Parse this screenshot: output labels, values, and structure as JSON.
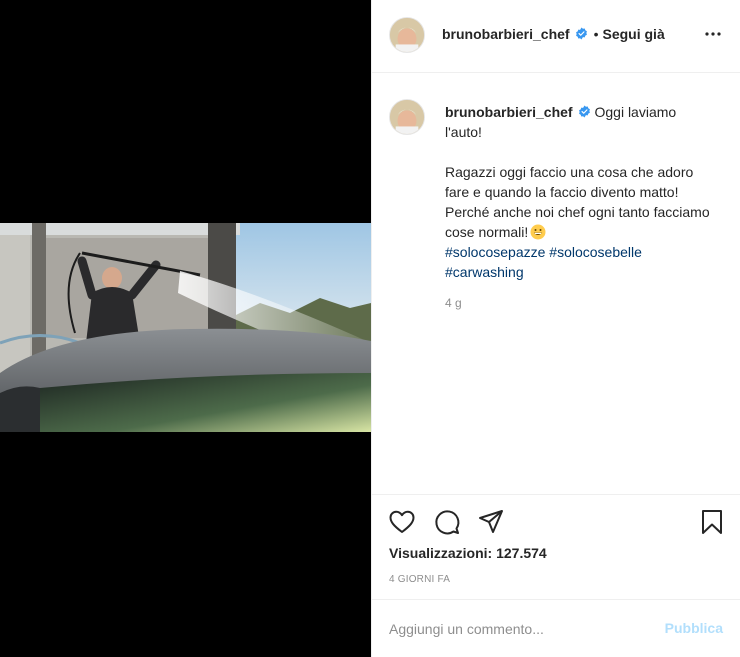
{
  "post": {
    "username": "brunobarbieri_chef",
    "follow_separator": "•",
    "follow_label": "Segui già",
    "caption_head": "Oggi laviamo l'auto!",
    "caption_body": "Ragazzi oggi faccio una cosa che adoro fare e quando la faccio divento matto! Perché anche noi chef ogni tanto facciamo cose normali!",
    "hashtags": [
      "#solocosepazze",
      "#solocosebelle",
      "#carwashing"
    ],
    "time_ago": "4 g",
    "views_label": "Visualizzazioni:",
    "views_count": "127.574",
    "date_label": "4 GIORNI FA"
  },
  "comment_box": {
    "placeholder": "Aggiungi un commento...",
    "publish_label": "Pubblica"
  },
  "icons": {
    "verified": "verified-badge-icon",
    "more": "more-options-icon",
    "like": "heart-icon",
    "comment": "comment-icon",
    "share": "paper-plane-icon",
    "save": "bookmark-icon",
    "emoji": "grinning-face-icon"
  },
  "colors": {
    "verified_blue": "#3897f0",
    "hashtag": "#00376b",
    "publish_disabled": "#b2dffc",
    "muted_text": "#8e8e8e"
  }
}
